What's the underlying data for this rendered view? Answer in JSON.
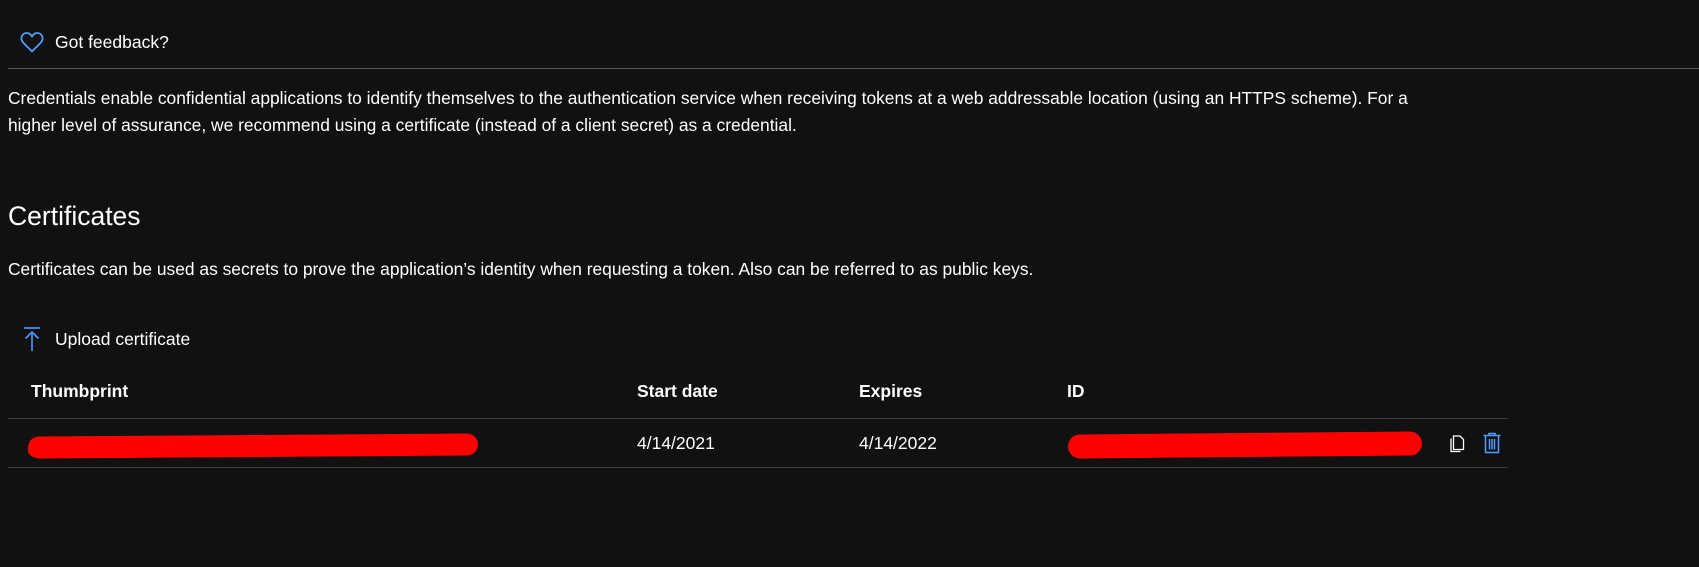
{
  "feedback": {
    "label": "Got feedback?",
    "icon": "heart-icon"
  },
  "intro": "Credentials enable confidential applications to identify themselves to the authentication service when receiving tokens at a web addressable location (using an HTTPS scheme). For a higher level of assurance, we recommend using a certificate (instead of a client secret) as a credential.",
  "certificates": {
    "title": "Certificates",
    "description": "Certificates can be used as secrets to prove the application’s identity when requesting a token. Also can be referred to as public keys.",
    "upload_label": "Upload certificate",
    "upload_icon": "upload-icon",
    "columns": [
      "Thumbprint",
      "Start date",
      "Expires",
      "ID"
    ],
    "rows": [
      {
        "start_date": "4/14/2021",
        "expires": "4/14/2022"
      }
    ]
  },
  "colors": {
    "background": "#111111",
    "text": "#ffffff",
    "accent": "#4f9bff",
    "divider": "#3c3c3c",
    "redaction": "#ff0000"
  }
}
